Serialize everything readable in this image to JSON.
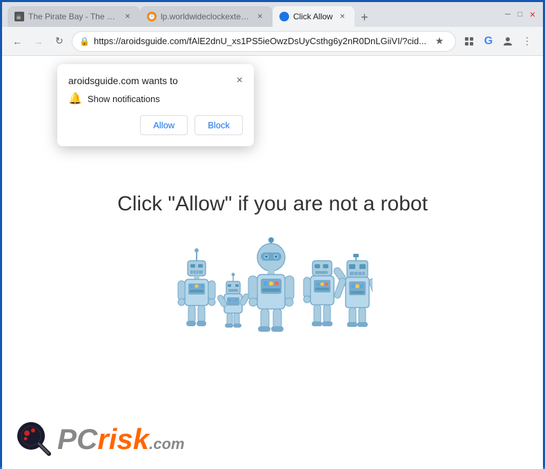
{
  "window": {
    "title": "Click Allow"
  },
  "titlebar": {
    "minimize_label": "─",
    "maximize_label": "□",
    "close_label": "✕"
  },
  "tabs": [
    {
      "id": "tab1",
      "title": "The Pirate Bay - The gal...",
      "favicon_color": "#555",
      "active": false
    },
    {
      "id": "tab2",
      "title": "lp.worldwideclockextens...",
      "favicon_color": "#ff8800",
      "active": false
    },
    {
      "id": "tab3",
      "title": "Click Allow",
      "favicon_color": "#1a73e8",
      "active": true
    }
  ],
  "addressbar": {
    "url": "https://aroidsguide.com/fAlE2dnU_xs1PS5ieOwzDsUyCsthg6y2nR0DnLGiiVI/?cid...",
    "back_disabled": false,
    "forward_disabled": true
  },
  "popup": {
    "title": "aroidsguide.com wants to",
    "close_label": "×",
    "notification_label": "Show notifications",
    "allow_label": "Allow",
    "block_label": "Block"
  },
  "page": {
    "main_text": "Click \"Allow\"   if you are not   a robot"
  },
  "logo": {
    "pc_text": "PC",
    "risk_text": "risk",
    "com_text": ".com"
  }
}
